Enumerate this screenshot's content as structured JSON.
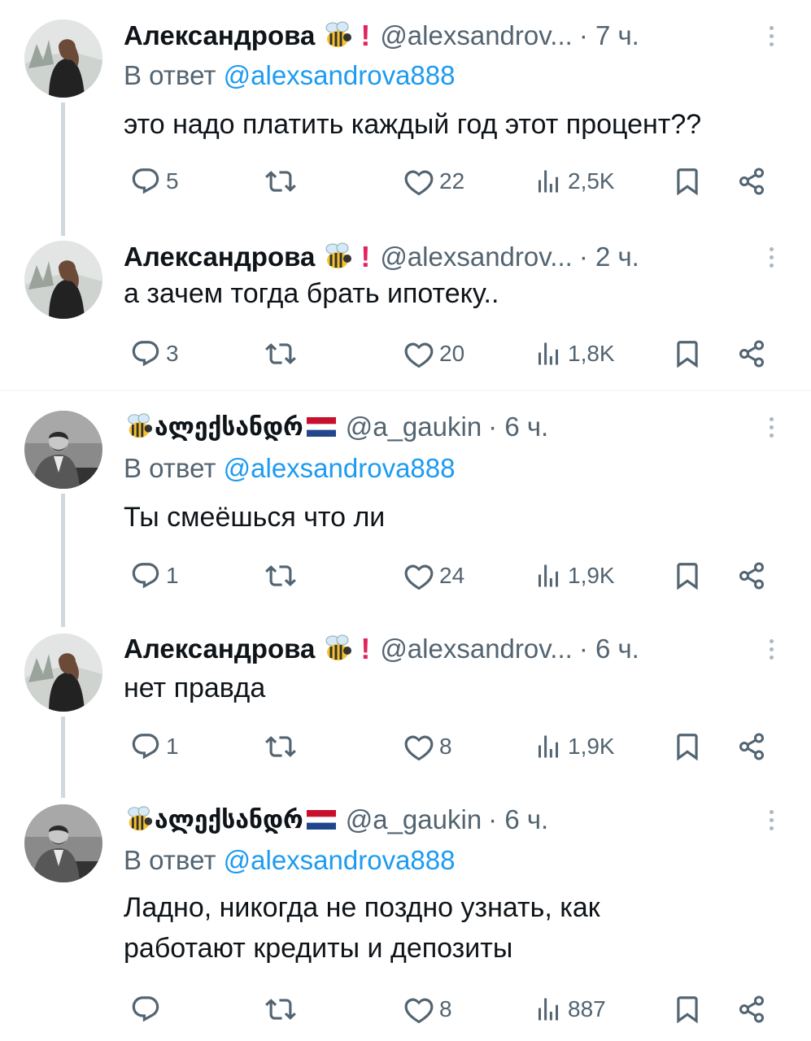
{
  "tweets": [
    {
      "name": "Александрова",
      "handle": "@alexsandrov...",
      "time": "· 7 ч.",
      "reply_label": "В ответ",
      "reply_mention": "@alexsandrova888",
      "text": "это надо платить каждый год этот процент??",
      "replies": "5",
      "retweets": "",
      "likes": "22",
      "views": "2,5K"
    },
    {
      "name": "Александрова",
      "handle": "@alexsandrov...",
      "time": "· 2 ч.",
      "text": "а зачем тогда брать ипотеку..",
      "replies": "3",
      "retweets": "",
      "likes": "20",
      "views": "1,8K"
    },
    {
      "name": "ალექსანდრ",
      "handle": "@a_gaukin",
      "time": "· 6 ч.",
      "reply_label": "В ответ",
      "reply_mention": "@alexsandrova888",
      "text": "Ты смеёшься что ли",
      "replies": "1",
      "retweets": "",
      "likes": "24",
      "views": "1,9K"
    },
    {
      "name": "Александрова",
      "handle": "@alexsandrov...",
      "time": "· 6 ч.",
      "text": "нет правда",
      "replies": "1",
      "retweets": "",
      "likes": "8",
      "views": "1,9K"
    },
    {
      "name": "ალექსანდრ",
      "handle": "@a_gaukin",
      "time": "· 6 ч.",
      "reply_label": "В ответ",
      "reply_mention": "@alexsandrova888",
      "text_line1": "Ладно, никогда не поздно узнать, как",
      "text_line2": "работают кредиты и депозиты",
      "replies": "",
      "retweets": "",
      "likes": "8",
      "views": "887"
    }
  ],
  "icons": {
    "reply": "reply-icon",
    "retweet": "retweet-icon",
    "like": "heart-icon",
    "views": "views-icon",
    "bookmark": "bookmark-icon",
    "share": "share-icon",
    "more": "more-vertical-icon",
    "badge_bee": "bee-emoji-icon",
    "badge_exclaim": "exclamation-icon",
    "flag": "netherlands-flag-icon"
  },
  "colors": {
    "text": "#0f1419",
    "secondary": "#536471",
    "link": "#1d9bf0",
    "thread_line": "#cfd9de",
    "exclaim": "#e0245e"
  }
}
